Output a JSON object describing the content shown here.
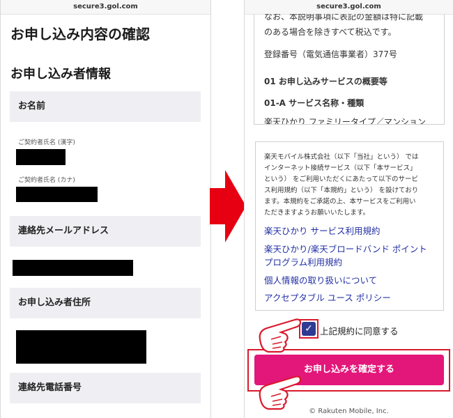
{
  "left_screen": {
    "url": "secure3.gol.com",
    "page_title": "お申し込み内容の確認",
    "section_title": "お申し込み者情報",
    "name_header": "お名前",
    "kanji_label": "ご契約者氏名 (漢字)",
    "kana_label": "ご契約者氏名 (カナ)",
    "email_header": "連絡先メールアドレス",
    "address_header": "お申し込み者住所",
    "phone_header": "連絡先電話番号"
  },
  "right_screen": {
    "url": "secure3.gol.com",
    "clipped_top_line1": "なお、本説明事項に表記の金額は特に記載",
    "clipped_top_line2": "のある場合を除きすべて税込です。",
    "registration": "登録番号（電気通信事業者）377号",
    "heading_01": "01 お申し込みサービスの概要等",
    "heading_01a": "01-A サービス名称・種類",
    "clipped_bottom_line": "楽天ひかり ファミリータイプ／マンション",
    "terms_lines": [
      "楽天モバイル株式会社（以下「当社」という） では",
      "インターネット接続サービス（以下「本サービス」",
      "という） をご利用いただくにあたって以下のサービ",
      "ス利用規約（以下「本規約」という） を設けており",
      "ます。本規約をご承諾の上、本サービスをご利用い",
      "ただきますようお願いいたします。"
    ],
    "links": [
      "楽天ひかり サービス利用規約",
      "楽天ひかり/楽天ブロードバンド ポイント",
      "プログラム利用規約",
      "個人情報の取り扱いについて",
      "アクセプタブル ユース ポリシー"
    ],
    "agree_label": "上記規約に同意する",
    "agree_checked": true,
    "confirm_button": "お申し込みを確定する",
    "footer": "© Rakuten Mobile, Inc."
  },
  "colors": {
    "confirm_button": "#e3167a",
    "checkbox": "#2f3a92",
    "link": "#2330a5",
    "highlight_frame": "#d9192c",
    "arrow": "#e60012"
  },
  "icons": [
    "right-arrow-icon",
    "pointing-hand-icon",
    "check-icon"
  ]
}
